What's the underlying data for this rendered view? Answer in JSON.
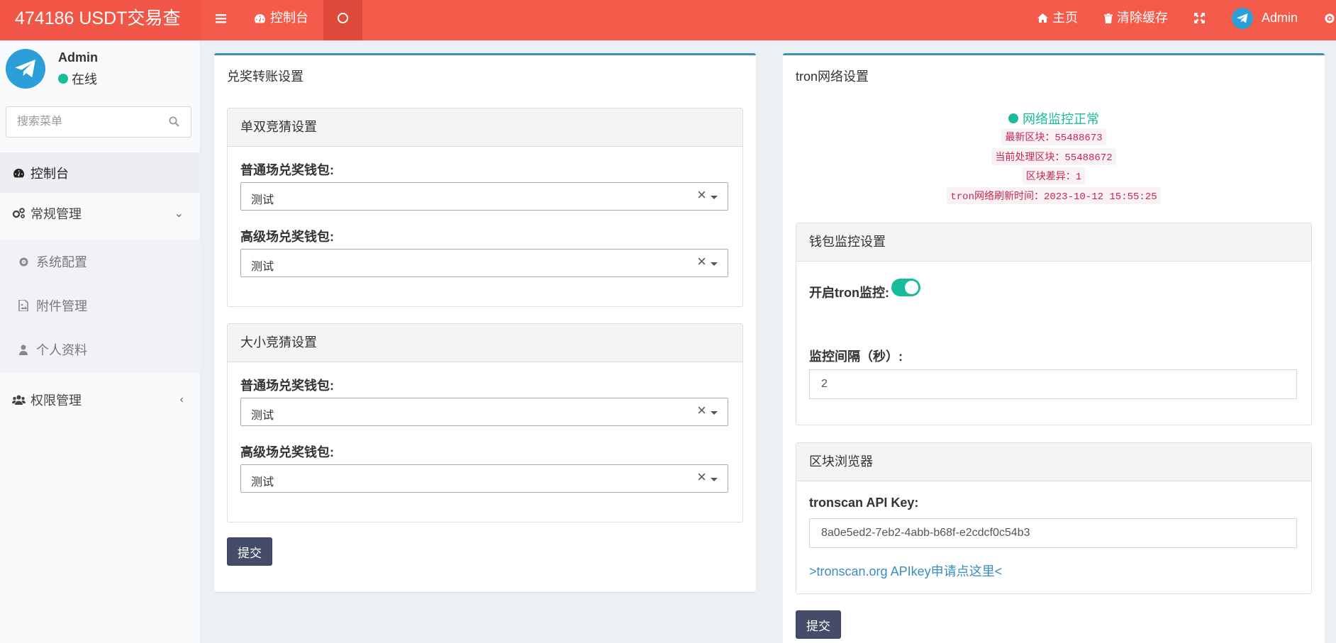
{
  "header": {
    "logo": "474186 USDT交易查",
    "nav_dashboard": "控制台",
    "home": "主页",
    "clear_cache": "清除缓存",
    "user": "Admin"
  },
  "sidebar": {
    "user_name": "Admin",
    "user_status": "在线",
    "search_placeholder": "搜索菜单",
    "items": [
      {
        "label": "控制台"
      },
      {
        "label": "常规管理"
      },
      {
        "label": "系统配置"
      },
      {
        "label": "附件管理"
      },
      {
        "label": "个人资料"
      },
      {
        "label": "权限管理"
      }
    ]
  },
  "left_panel": {
    "title": "兑奖转账设置",
    "box1": {
      "title": "单双竞猜设置",
      "label1": "普通场兑奖钱包:",
      "value1": "测试",
      "label2": "高级场兑奖钱包:",
      "value2": "测试"
    },
    "box2": {
      "title": "大小竞猜设置",
      "label1": "普通场兑奖钱包:",
      "value1": "测试",
      "label2": "高级场兑奖钱包:",
      "value2": "测试"
    },
    "submit": "提交"
  },
  "right_panel": {
    "title": "tron网络设置",
    "status": "网络监控正常",
    "latest_block": "最新区块：55488673",
    "current_block": "当前处理区块：55488672",
    "block_diff": "区块差异：1",
    "refresh_time": "tron网络刷新时间：2023-10-12 15:55:25",
    "wallet_box": {
      "title": "钱包监控设置",
      "toggle_label": "开启tron监控:",
      "toggle_on": true,
      "interval_label": "监控间隔（秒）:",
      "interval_value": "2"
    },
    "explorer_box": {
      "title": "区块浏览器",
      "api_label": "tronscan API Key:",
      "api_value": "8a0e5ed2-7eb2-4abb-b68f-e2cdcf0c54b3",
      "link": ">tronscan.org APIkey申请点这里<"
    },
    "submit": "提交"
  },
  "colors": {
    "topbar": "#f45b4a",
    "accent": "#3c8dbc",
    "success": "#1abc9c",
    "button": "#444c69"
  }
}
